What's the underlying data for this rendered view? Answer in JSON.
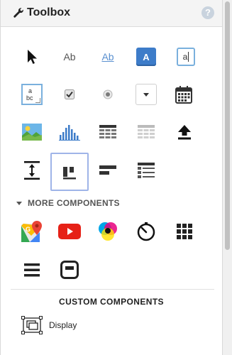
{
  "header": {
    "title": "Toolbox",
    "help_text": "?",
    "title_icon": "wrench-icon"
  },
  "tools": [
    {
      "name": "pointer",
      "icon": "cursor-arrow-icon"
    },
    {
      "name": "label",
      "icon": "label-icon",
      "text": "Ab"
    },
    {
      "name": "link",
      "icon": "link-icon",
      "text": "Ab"
    },
    {
      "name": "button",
      "icon": "button-icon",
      "text": "A"
    },
    {
      "name": "textbox",
      "icon": "textbox-icon",
      "text": "a"
    },
    {
      "name": "textarea",
      "icon": "textarea-icon",
      "text_line1": "a",
      "text_line2": "bc"
    },
    {
      "name": "checkbox",
      "icon": "checkbox-icon"
    },
    {
      "name": "radio",
      "icon": "radio-button-icon"
    },
    {
      "name": "dropdown",
      "icon": "dropdown-icon"
    },
    {
      "name": "calendar",
      "icon": "calendar-icon"
    },
    {
      "name": "image",
      "icon": "image-icon"
    },
    {
      "name": "chart",
      "icon": "bar-chart-icon"
    },
    {
      "name": "grid",
      "icon": "data-grid-icon"
    },
    {
      "name": "table",
      "icon": "table-icon"
    },
    {
      "name": "upload",
      "icon": "upload-icon"
    },
    {
      "name": "spacer",
      "icon": "vertical-spacer-icon"
    },
    {
      "name": "columns",
      "icon": "columns-layout-icon"
    },
    {
      "name": "rows",
      "icon": "rows-layout-icon"
    },
    {
      "name": "list",
      "icon": "list-view-icon"
    }
  ],
  "more_components": {
    "heading": "MORE COMPONENTS",
    "items": [
      {
        "name": "google-maps",
        "icon": "google-maps-icon"
      },
      {
        "name": "youtube",
        "icon": "youtube-icon"
      },
      {
        "name": "color-picker",
        "icon": "color-wheel-icon"
      },
      {
        "name": "timer",
        "icon": "timer-icon"
      },
      {
        "name": "app-grid",
        "icon": "app-grid-icon"
      },
      {
        "name": "hamburger-menu",
        "icon": "hamburger-menu-icon"
      },
      {
        "name": "container",
        "icon": "container-icon"
      }
    ]
  },
  "custom_components": {
    "heading": "CUSTOM COMPONENTS",
    "items": [
      {
        "label": "Display",
        "icon": "display-component-icon"
      }
    ]
  },
  "colors": {
    "header_bg": "#f4f4f4",
    "accent_blue": "#3d7cc9",
    "selected_border": "#9fb4e8",
    "icon_dark": "#222222"
  }
}
